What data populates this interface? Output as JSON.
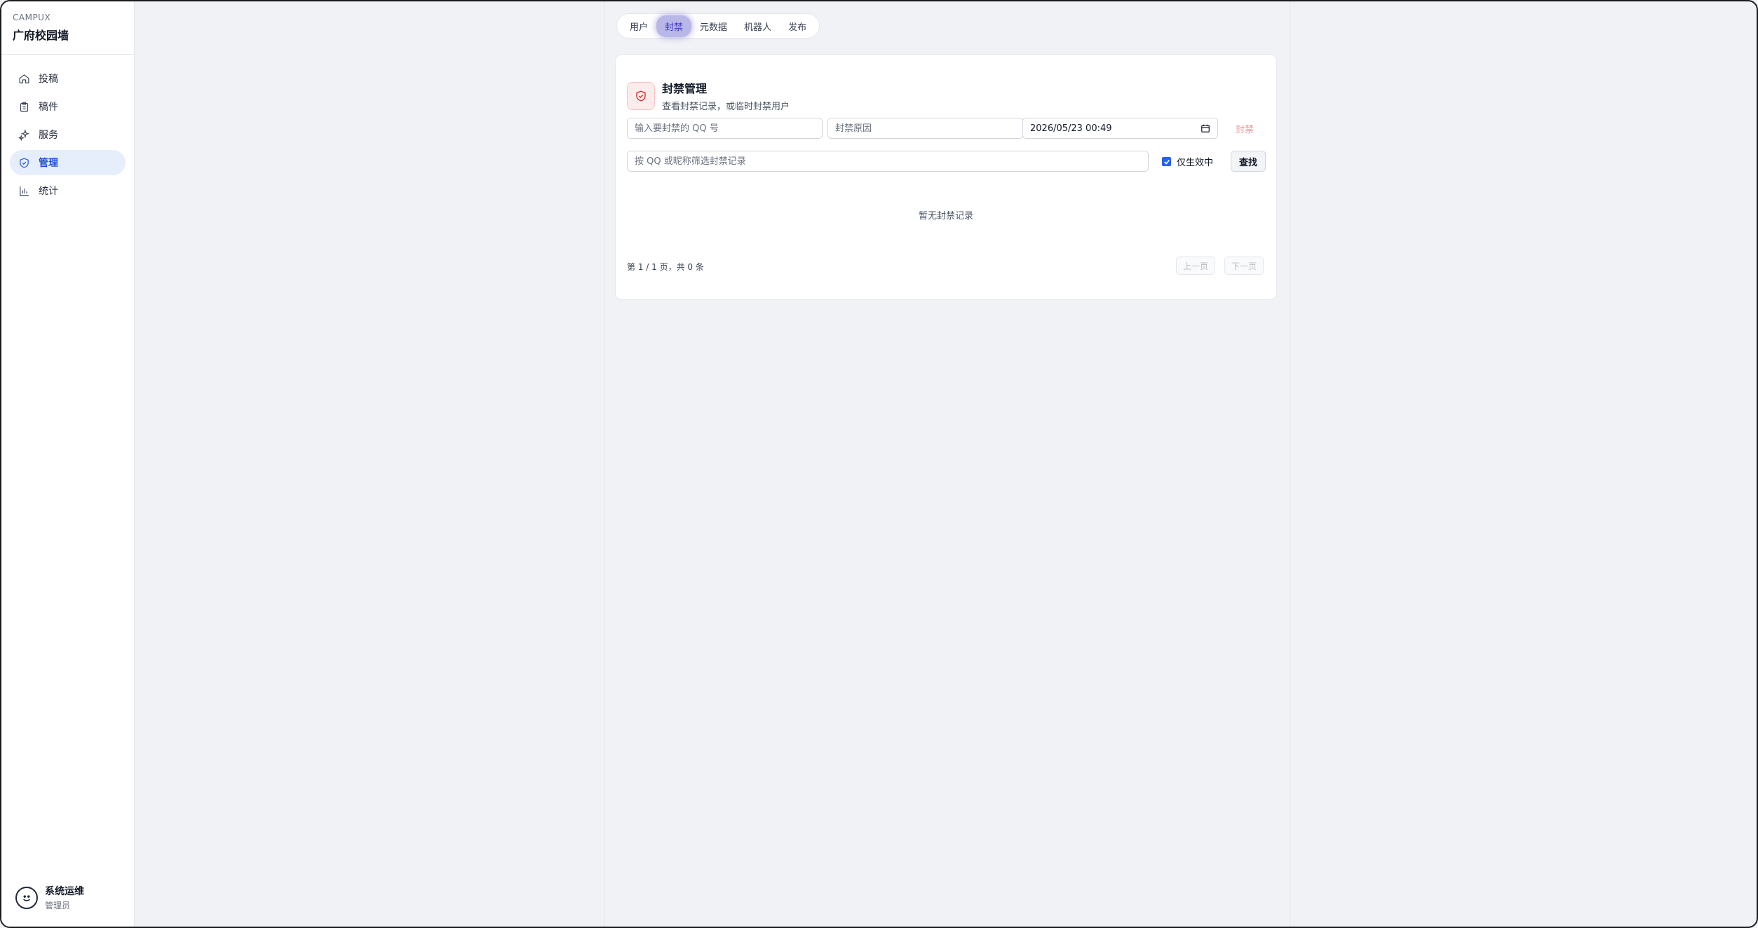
{
  "brand": {
    "sub": "CAMPUX",
    "title": "广府校园墙"
  },
  "sidebar": {
    "items": [
      {
        "label": "投稿",
        "icon": "home-icon",
        "active": false
      },
      {
        "label": "稿件",
        "icon": "clipboard-icon",
        "active": false
      },
      {
        "label": "服务",
        "icon": "sparkle-icon",
        "active": false
      },
      {
        "label": "管理",
        "icon": "shield-icon",
        "active": true
      },
      {
        "label": "统计",
        "icon": "bar-chart-icon",
        "active": false
      }
    ]
  },
  "user": {
    "name": "系统运维",
    "role": "管理员"
  },
  "tabs": [
    {
      "label": "用户"
    },
    {
      "label": "封禁",
      "active": true
    },
    {
      "label": "元数据"
    },
    {
      "label": "机器人"
    },
    {
      "label": "发布"
    }
  ],
  "card": {
    "title": "封禁管理",
    "description": "查看封禁记录，或临时封禁用户",
    "qq_placeholder": "输入要封禁的 QQ 号",
    "reason_placeholder": "封禁原因",
    "date_value": "2026/05/23 00:49",
    "ban_label": "封禁",
    "filter_placeholder": "按 QQ 或昵称筛选封禁记录",
    "active_only_label": "仅生效中",
    "active_only_checked": true,
    "search_label": "查找",
    "empty_text": "暂无封禁记录",
    "pager_text": "第 1 / 1 页，共 0 条",
    "prev_label": "上一页",
    "next_label": "下一页"
  },
  "colors": {
    "accent": "#1d4ed8",
    "danger": "#f19393",
    "background": "#f1f2f6"
  }
}
